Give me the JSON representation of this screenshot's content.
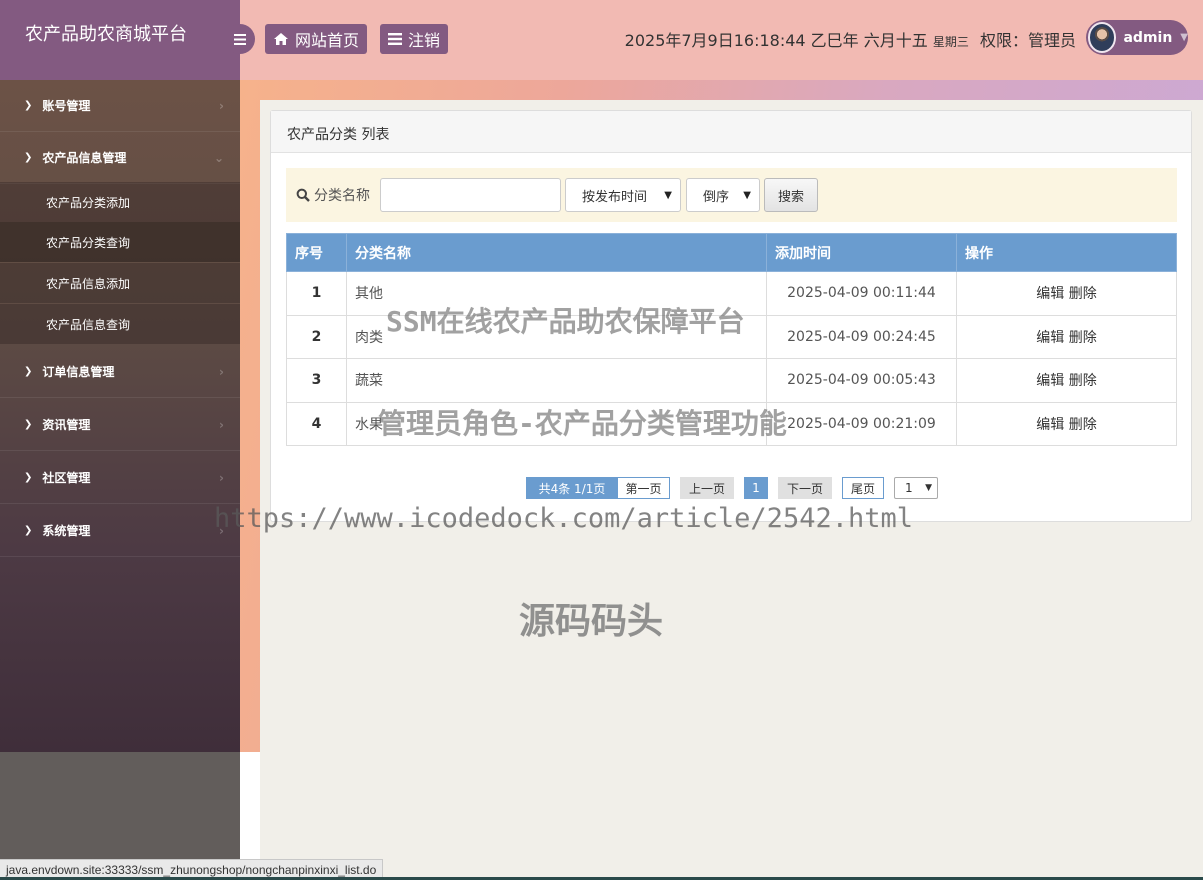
{
  "header": {
    "app_title": "农产品助农商城平台",
    "home_label": "网站首页",
    "logout_label": "注销",
    "datetime": "2025年7月9日16:18:44 乙巳年 六月十五",
    "weekday": "星期三",
    "role_label": "权限：管理员",
    "username": "admin"
  },
  "sidebar": {
    "items": [
      {
        "label": "账号管理"
      },
      {
        "label": "农产品信息管理"
      },
      {
        "label": "订单信息管理"
      },
      {
        "label": "资讯管理"
      },
      {
        "label": "社区管理"
      },
      {
        "label": "系统管理"
      }
    ],
    "subitems": [
      {
        "label": "农产品分类添加"
      },
      {
        "label": "农产品分类查询"
      },
      {
        "label": "农产品信息添加"
      },
      {
        "label": "农产品信息查询"
      }
    ]
  },
  "panel": {
    "title": "农产品分类 列表",
    "search_label": "分类名称",
    "search_value": "",
    "sort_field": "按发布时间",
    "sort_order": "倒序",
    "search_button": "搜索"
  },
  "table": {
    "headers": [
      "序号",
      "分类名称",
      "添加时间",
      "操作"
    ],
    "rows": [
      {
        "id": "1",
        "name": "其他",
        "time": "2025-04-09 00:11:44",
        "edit": "编辑",
        "delete": "删除"
      },
      {
        "id": "2",
        "name": "肉类",
        "time": "2025-04-09 00:24:45",
        "edit": "编辑",
        "delete": "删除"
      },
      {
        "id": "3",
        "name": "蔬菜",
        "time": "2025-04-09 00:05:43",
        "edit": "编辑",
        "delete": "删除"
      },
      {
        "id": "4",
        "name": "水果",
        "time": "2025-04-09 00:21:09",
        "edit": "编辑",
        "delete": "删除"
      }
    ]
  },
  "pagination": {
    "info": "共4条  1/1页",
    "first": "第一页",
    "prev": "上一页",
    "current": "1",
    "next": "下一页",
    "last": "尾页",
    "page_select": "1"
  },
  "watermarks": {
    "line1": "SSM在线农产品助农保障平台",
    "line2": "管理员角色-农产品分类管理功能",
    "line3": "https://www.icodedock.com/article/2542.html",
    "line4": "源码码头"
  },
  "status_url": "java.envdown.site:33333/ssm_zhunongshop/nongchanpinxinxi_list.do",
  "colors": {
    "brand": "#835a81",
    "topbar": "#f2bab3",
    "table_header": "#6a9ccf",
    "search_bg": "#fbf5e1"
  },
  "icons": [
    "menu-icon",
    "home-icon",
    "list-icon",
    "search-icon",
    "chevron-right-icon",
    "chevron-down-icon",
    "caret-down-icon"
  ]
}
